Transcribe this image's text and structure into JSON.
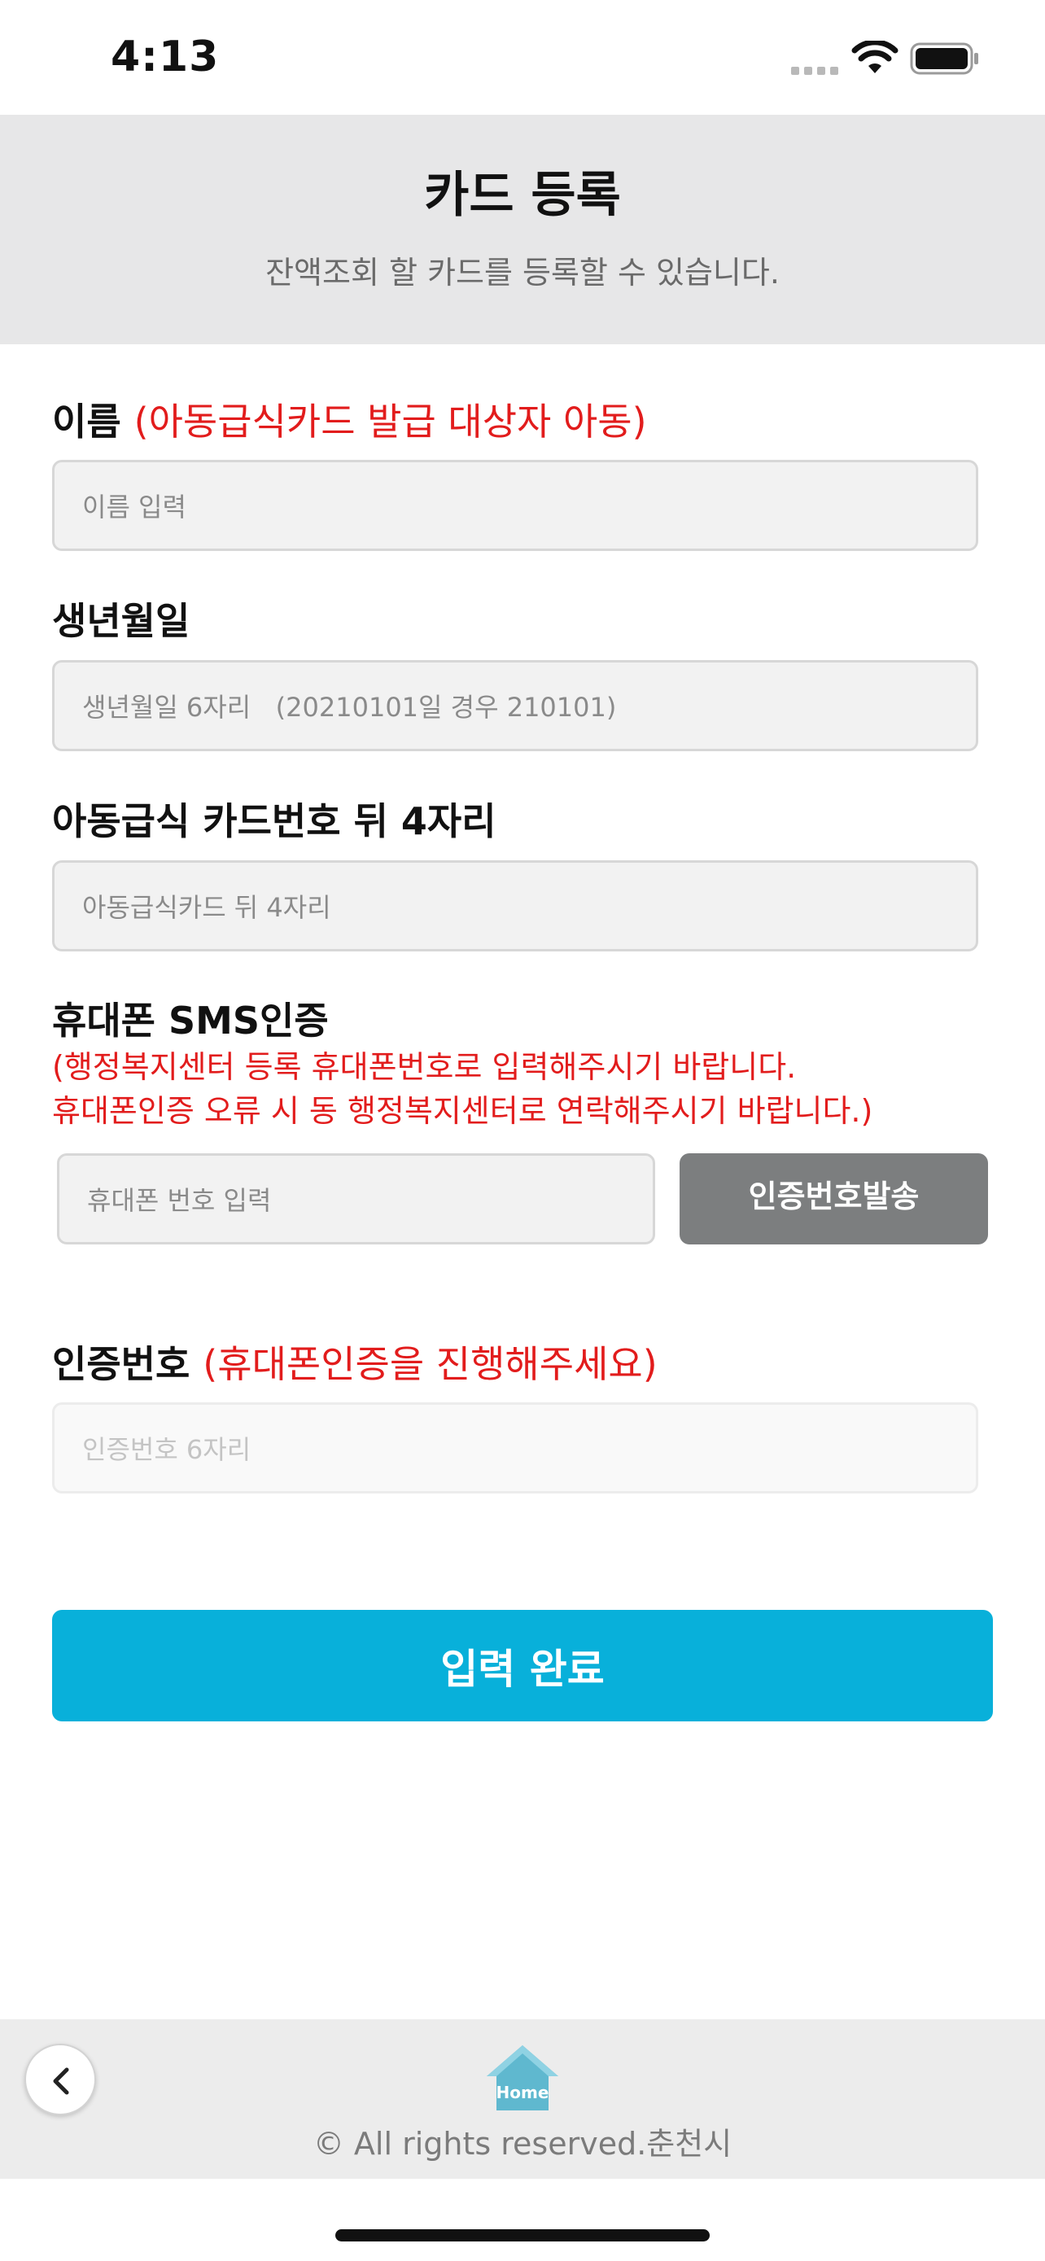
{
  "status_bar": {
    "time": "4:13",
    "icons": [
      "signal-icon",
      "wifi-icon",
      "battery-icon"
    ]
  },
  "header": {
    "title": "카드 등록",
    "subtitle": "잔액조회 할 카드를 등록할 수 있습니다."
  },
  "form": {
    "name": {
      "label": "이름",
      "note": "(아동급식카드 발급 대상자 아동)",
      "placeholder": "이름 입력",
      "value": ""
    },
    "birth": {
      "label": "생년월일",
      "placeholder": "생년월일 6자리   (20210101일 경우 210101)",
      "value": ""
    },
    "card": {
      "label": "아동급식 카드번호 뒤 4자리",
      "placeholder": "아동급식카드 뒤 4자리",
      "value": ""
    },
    "phone": {
      "label": "휴대폰 SMS인증",
      "note_line1": "(행정복지센터 등록 휴대폰번호로 입력해주시기 바랍니다.",
      "note_line2": "휴대폰인증 오류 시 동 행정복지센터로 연락해주시기 바랍니다.)",
      "placeholder": "휴대폰 번호 입력",
      "value": "",
      "send_button": "인증번호발송"
    },
    "code": {
      "label": "인증번호",
      "note": "(휴대폰인증을 진행해주세요)",
      "placeholder": "인증번호 6자리",
      "value": "",
      "disabled": true
    },
    "submit_label": "입력 완료"
  },
  "footer": {
    "home_label": "Home",
    "copyright": "© All rights reserved.춘천시"
  },
  "colors": {
    "accent": "#08b0da",
    "warning_text": "#e21c1c",
    "send_button": "#7c7e7f",
    "header_bg": "#e7e7e8",
    "home_icon": "#5fb8cf"
  }
}
